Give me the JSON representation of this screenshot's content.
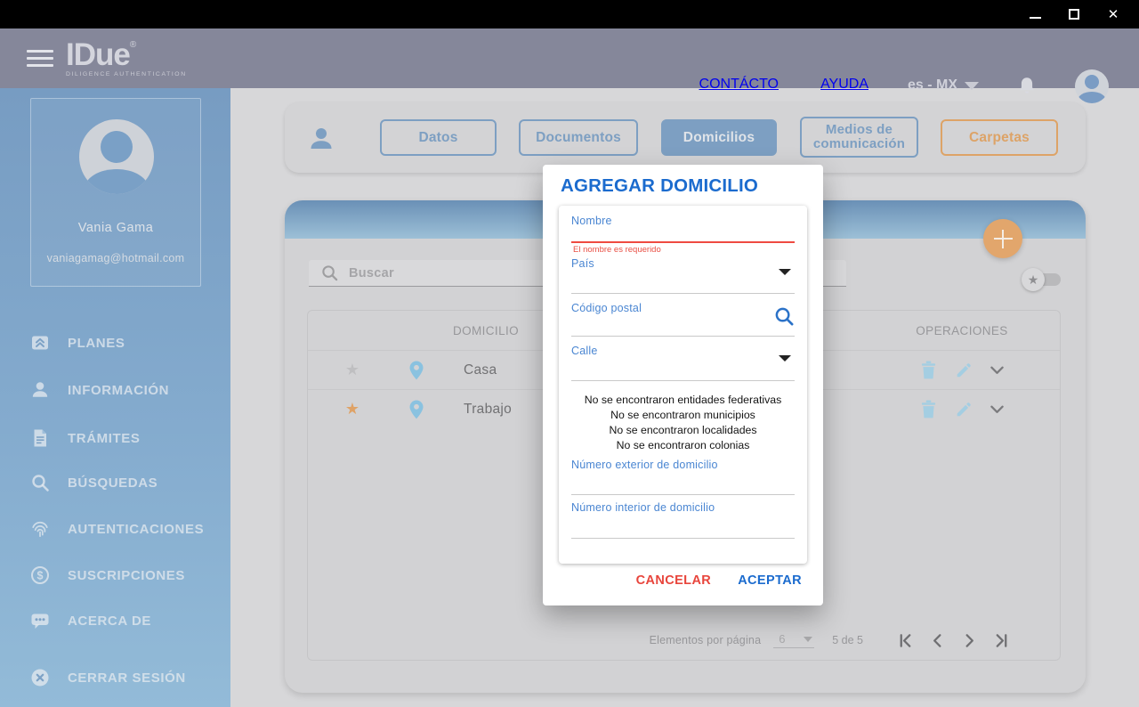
{
  "header": {
    "logo_text": "IDue",
    "logo_mark": "®",
    "logo_subtitle": "DILIGENCE AUTHENTICATION",
    "contact_label": "CONTÁCTO",
    "help_label": "AYUDA",
    "language_label": "es - MX"
  },
  "sidebar": {
    "profile": {
      "name": "Vania Gama",
      "email": "vaniagamag@hotmail.com"
    },
    "items": [
      {
        "label": "PLANES",
        "icon": "plans-icon"
      },
      {
        "label": "INFORMACIÓN",
        "icon": "person-icon"
      },
      {
        "label": "TRÁMITES",
        "icon": "document-icon"
      },
      {
        "label": "BÚSQUEDAS",
        "icon": "search-icon"
      },
      {
        "label": "AUTENTICACIONES",
        "icon": "fingerprint-icon"
      },
      {
        "label": "SUSCRIPCIONES",
        "icon": "dollar-icon"
      },
      {
        "label": "ACERCA DE",
        "icon": "chat-icon"
      },
      {
        "label": "CERRAR SESIÓN",
        "icon": "logout-icon"
      }
    ]
  },
  "tabs": [
    {
      "label": "Datos",
      "active": false
    },
    {
      "label": "Documentos",
      "active": false
    },
    {
      "label": "Domicilios",
      "active": true
    },
    {
      "label": "Medios de comunicación",
      "active": false
    },
    {
      "label": "Carpetas",
      "active": false,
      "accent": "#dda367"
    }
  ],
  "content": {
    "search_placeholder": "Buscar",
    "table": {
      "domicilio_header": "DOMICILIO",
      "operaciones_header": "OPERACIONES",
      "rows": [
        {
          "name": "Casa",
          "favorite": false
        },
        {
          "name": "Trabajo",
          "favorite": true
        }
      ]
    },
    "pagination": {
      "items_label": "Elementos por página",
      "page_size": "6",
      "range_label": "5 de 5"
    }
  },
  "modal": {
    "title": "AGREGAR DOMICILIO",
    "name_label": "Nombre",
    "name_error": "El nombre es requerido",
    "country_label": "País",
    "postal_label": "Código postal",
    "street_label": "Calle",
    "messages": [
      "No se encontraron entidades federativas",
      "No se encontraron municipios",
      "No se encontraron localidades",
      "No se encontraron colonias"
    ],
    "ext_number_label": "Número exterior de domicilio",
    "int_number_label": "Número interior de domicilio",
    "cancel_label": "CANCELAR",
    "accept_label": "ACEPTAR"
  },
  "colors": {
    "accent_blue": "#1b6bce",
    "label_blue": "#4a86d2",
    "error_red": "#e94f44",
    "cancel_red": "#e8453c",
    "tab_blue": "#7d9fc2",
    "accent_orange": "#dfa266",
    "sidebar_top": "#779cc2",
    "sidebar_bottom": "#93bbd8",
    "header_gray": "#85879a"
  },
  "stars": {
    "favorite_glyph": "★"
  }
}
